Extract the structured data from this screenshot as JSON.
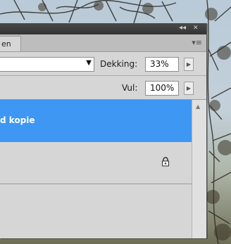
{
  "panel": {
    "tab_label": "en",
    "collapse_glyph": "◂◂",
    "close_glyph": "✕",
    "menu_icon": "panel-menu-icon"
  },
  "blend": {
    "opacity_label": "Dekking:",
    "opacity_value": "33%",
    "fill_label": "Vul:",
    "fill_value": "100%"
  },
  "layers": [
    {
      "name": "d kopie",
      "selected": true
    },
    {
      "name": "",
      "locked": true
    }
  ],
  "colors": {
    "selection": "#3d97f3",
    "panel_bg": "#d6d6d6",
    "titlebar": "#3b3b3b"
  }
}
